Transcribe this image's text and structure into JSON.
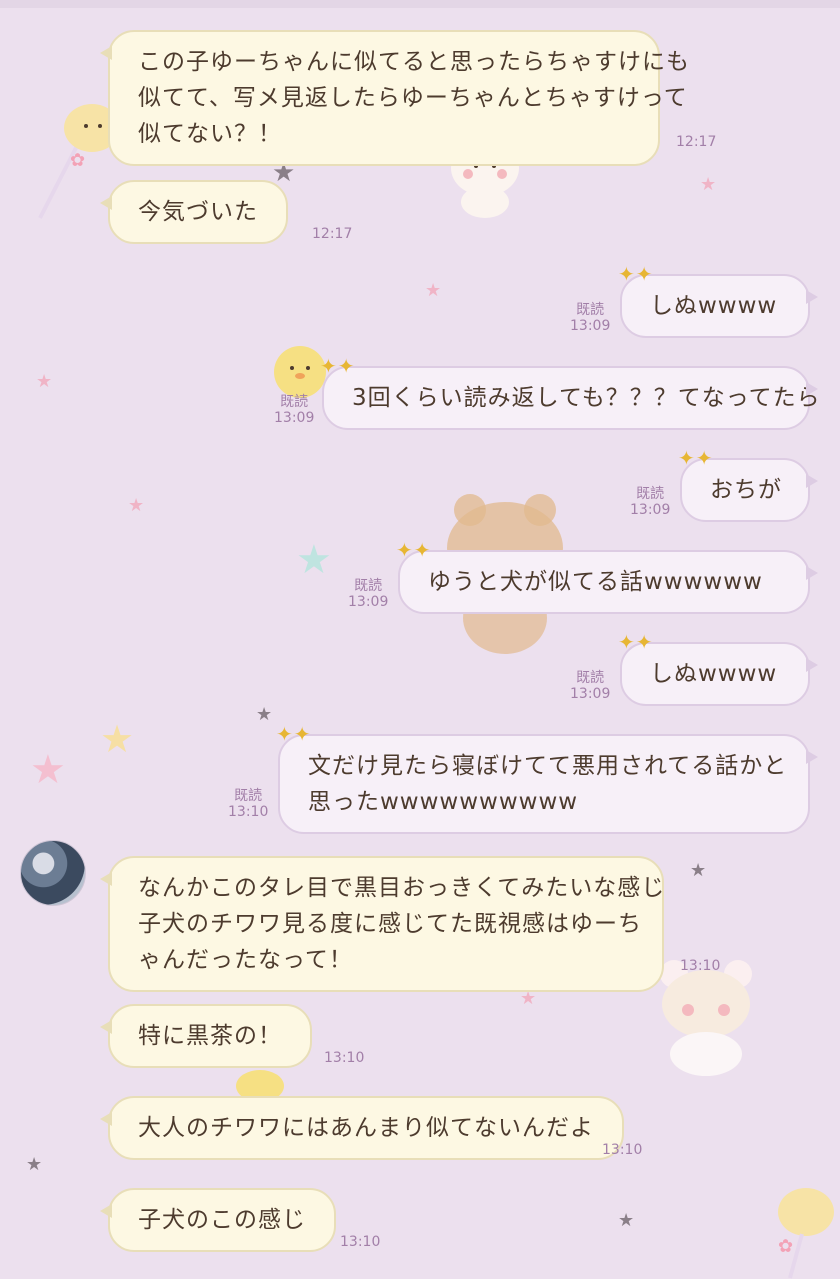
{
  "chat": {
    "read_label": "既読",
    "messages": [
      {
        "side": "recv",
        "lines": [
          "この子ゆーちゃんに似てると思ったらちゃすけにも",
          "似てて、写メ見返したらゆーちゃんとちゃすけって",
          "似てない？！"
        ],
        "time": "12:17"
      },
      {
        "side": "recv",
        "lines": [
          "今気づいた"
        ],
        "time": "12:17"
      },
      {
        "side": "sent",
        "lines": [
          "しぬwwww"
        ],
        "time": "13:09",
        "read": "既読"
      },
      {
        "side": "sent",
        "lines": [
          "3回くらい読み返しても？？？てなってたら"
        ],
        "time": "13:09",
        "read": "既読"
      },
      {
        "side": "sent",
        "lines": [
          "おちが"
        ],
        "time": "13:09",
        "read": "既読"
      },
      {
        "side": "sent",
        "lines": [
          "ゆうと犬が似てる話wwwwww"
        ],
        "time": "13:09",
        "read": "既読"
      },
      {
        "side": "sent",
        "lines": [
          "しぬwwww"
        ],
        "time": "13:09",
        "read": "既読"
      },
      {
        "side": "sent",
        "lines": [
          "文だけ見たら寝ぼけてて悪用されてる話かと",
          "思ったwwwwwwwwww"
        ],
        "time": "13:10",
        "read": "既読"
      },
      {
        "side": "recv",
        "lines": [
          "なんかこのタレ目で黒目おっきくてみたいな感じ",
          "子犬のチワワ見る度に感じてた既視感はゆーち",
          "ゃんだったなって！"
        ],
        "time": "13:10"
      },
      {
        "side": "recv",
        "lines": [
          "特に黒茶の！"
        ],
        "time": "13:10"
      },
      {
        "side": "recv",
        "lines": [
          "大人のチワワにはあんまり似てないんだよ"
        ],
        "time": "13:10"
      },
      {
        "side": "recv",
        "lines": [
          "子犬のこの感じ"
        ],
        "time": "13:10"
      }
    ]
  },
  "decor": {
    "star_pink": "#f0b4c6",
    "star_gray": "#8a7f88",
    "icons": [
      "bear-icon",
      "chick-icon",
      "candy-icon"
    ]
  }
}
